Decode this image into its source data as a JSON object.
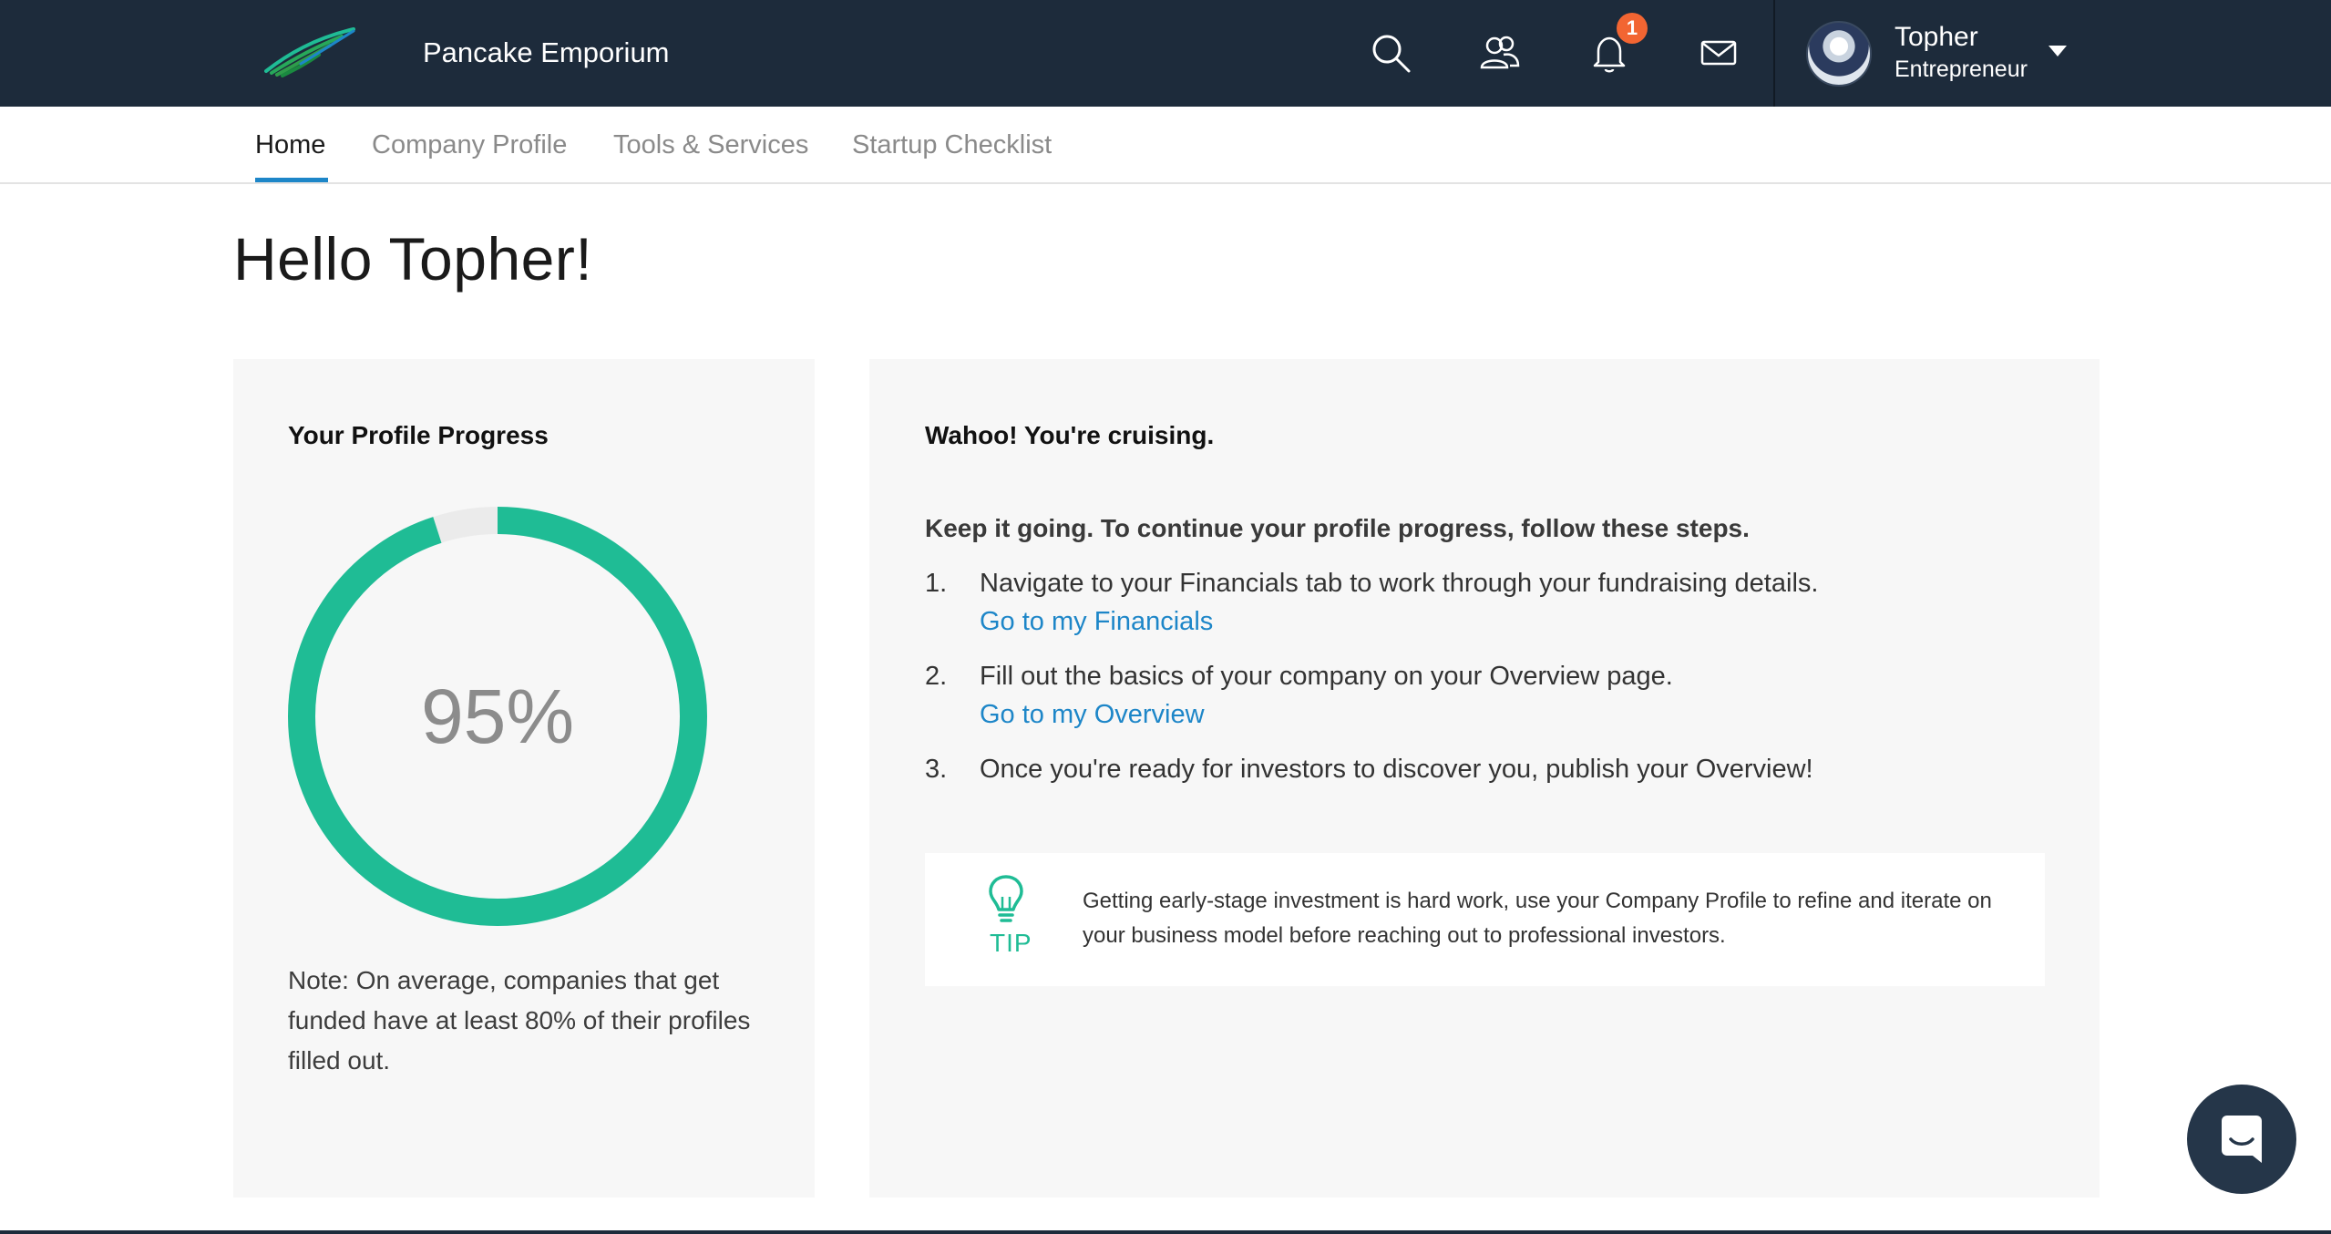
{
  "topbar": {
    "company_name": "Pancake Emporium",
    "icons": [
      "search-icon",
      "people-icon",
      "bell-icon",
      "mail-icon"
    ],
    "notification_count": "1",
    "user": {
      "name": "Topher",
      "role": "Entrepreneur"
    }
  },
  "nav": {
    "tabs": [
      {
        "label": "Home",
        "active": true
      },
      {
        "label": "Company Profile",
        "active": false
      },
      {
        "label": "Tools & Services",
        "active": false
      },
      {
        "label": "Startup Checklist",
        "active": false
      }
    ]
  },
  "greeting": "Hello Topher!",
  "progress_card": {
    "title": "Your Profile Progress",
    "percent_label": "95%",
    "percent_value": 95,
    "note": "Note: On average, companies that get funded have at least 80% of their profiles filled out."
  },
  "steps_card": {
    "title": "Wahoo! You're cruising.",
    "lead": "Keep it going. To continue your profile progress, follow these steps.",
    "steps": [
      {
        "num": "1.",
        "text": "Navigate to your Financials tab to work through your fundraising details.",
        "link": "Go to my Financials"
      },
      {
        "num": "2.",
        "text": "Fill out the basics of your company on your Overview page.",
        "link": "Go to my Overview"
      },
      {
        "num": "3.",
        "text": "Once you're ready for investors to discover you, publish your Overview!",
        "link": ""
      }
    ],
    "tip": {
      "label": "TIP",
      "text": "Getting early-stage investment is hard work, use your Company Profile to refine and iterate on your business model before reaching out to professional investors."
    }
  },
  "colors": {
    "topbar": "#1d2b3b",
    "accent_green": "#1fbc95",
    "link_blue": "#1d86c8",
    "badge_orange": "#f26532",
    "card_bg": "#f7f7f7"
  }
}
